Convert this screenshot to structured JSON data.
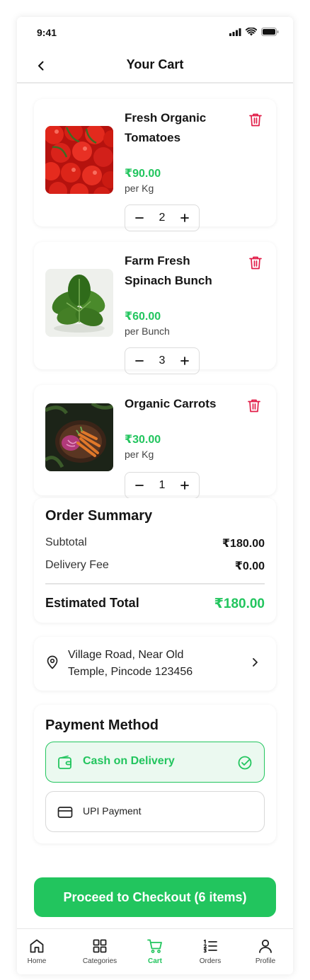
{
  "status_bar": {
    "time": "9:41"
  },
  "header": {
    "title": "Your Cart"
  },
  "cart_items": [
    {
      "name": "Fresh Organic Tomatoes",
      "price": "₹90.00",
      "unit": "per Kg",
      "quantity": "2"
    },
    {
      "name": "Farm Fresh Spinach Bunch",
      "price": "₹60.00",
      "unit": "per Bunch",
      "quantity": "3"
    },
    {
      "name": "Organic Carrots",
      "price": "₹30.00",
      "unit": "per Kg",
      "quantity": "1"
    }
  ],
  "order_summary": {
    "title": "Order Summary",
    "subtotal_label": "Subtotal",
    "subtotal_value": "₹180.00",
    "delivery_label": "Delivery Fee",
    "delivery_value": "₹0.00",
    "total_label": "Estimated Total",
    "total_value": "₹180.00"
  },
  "address": {
    "line1": "Village Road, Near Old",
    "line2": "Temple, Pincode 123456"
  },
  "payment": {
    "title": "Payment Method",
    "options": [
      {
        "label": "Cash on Delivery",
        "selected": true
      },
      {
        "label": "UPI Payment",
        "selected": false
      }
    ]
  },
  "checkout": {
    "label": "Proceed to Checkout (6 items)"
  },
  "tab_bar": {
    "items": [
      {
        "label": "Home"
      },
      {
        "label": "Categories"
      },
      {
        "label": "Cart",
        "active": true
      },
      {
        "label": "Orders"
      },
      {
        "label": "Profile"
      }
    ]
  },
  "colors": {
    "accent": "#22c55e",
    "danger": "#e11d48",
    "selected_bg": "#ebf9f0"
  }
}
